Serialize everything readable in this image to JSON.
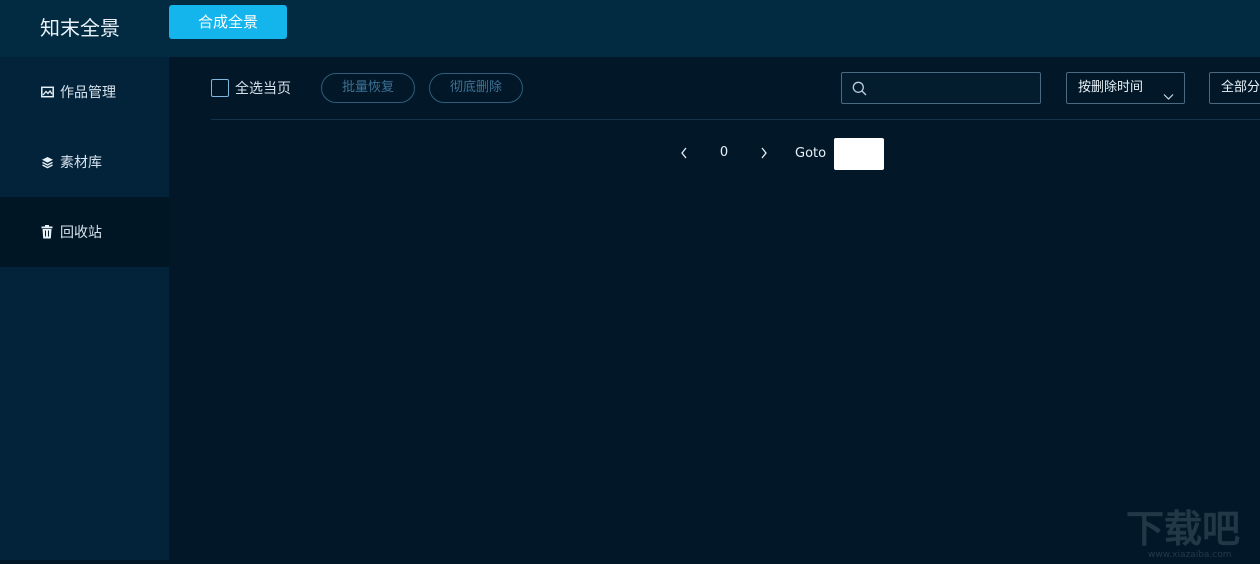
{
  "app": {
    "logo": "知末全景",
    "compose_button": "合成全景"
  },
  "sidebar": {
    "items": [
      {
        "label": "作品管理",
        "icon": "image-icon",
        "active": false
      },
      {
        "label": "素材库",
        "icon": "layers-icon",
        "active": false
      },
      {
        "label": "回收站",
        "icon": "trash-icon",
        "active": true
      }
    ]
  },
  "toolbar": {
    "select_all_label": "全选当页",
    "select_all_checked": false,
    "batch_restore": "批量恢复",
    "permanent_delete": "彻底删除",
    "search_value": "",
    "sort_select": "按删除时间",
    "category_select": "全部分"
  },
  "pagination": {
    "current_page": "0",
    "goto_label": "Goto",
    "goto_value": ""
  },
  "colors": {
    "accent": "#14b4ec",
    "topbar": "#022a40",
    "sidebar": "#03233a",
    "content": "#021828"
  },
  "watermark": {
    "text": "下载吧",
    "url": "www.xiazaiba.com"
  }
}
